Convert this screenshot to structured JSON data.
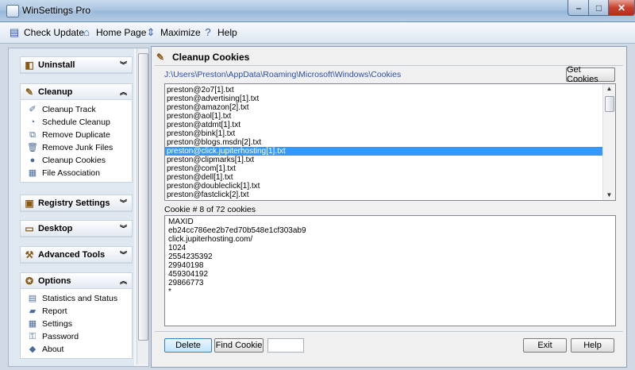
{
  "window": {
    "title": "WinSettings Pro"
  },
  "toolbar": {
    "items": [
      {
        "label": "Check Update",
        "icon": "check-update-icon"
      },
      {
        "label": "Home Page",
        "icon": "home-page-icon"
      },
      {
        "label": "Maximize",
        "icon": "maximize-icon"
      },
      {
        "label": "Help",
        "icon": "help-icon"
      }
    ]
  },
  "sidebar": {
    "groups": [
      {
        "label": "Uninstall",
        "icon": "uninstall-icon",
        "expanded": false
      },
      {
        "label": "Cleanup",
        "icon": "cleanup-icon",
        "expanded": true,
        "items": [
          {
            "label": "Cleanup Track",
            "icon": "cleanup-track-icon"
          },
          {
            "label": "Schedule Cleanup",
            "icon": "schedule-cleanup-icon"
          },
          {
            "label": "Remove Duplicate",
            "icon": "remove-duplicate-icon"
          },
          {
            "label": "Remove Junk Files",
            "icon": "remove-junk-icon"
          },
          {
            "label": "Cleanup Cookies",
            "icon": "cleanup-cookies-icon"
          },
          {
            "label": "File Association",
            "icon": "file-association-icon"
          }
        ]
      },
      {
        "label": "Registry Settings",
        "icon": "registry-icon",
        "expanded": false
      },
      {
        "label": "Desktop",
        "icon": "desktop-icon",
        "expanded": false
      },
      {
        "label": "Advanced Tools",
        "icon": "advanced-tools-icon",
        "expanded": false
      },
      {
        "label": "Options",
        "icon": "options-icon",
        "expanded": true,
        "items": [
          {
            "label": "Statistics and Status",
            "icon": "statistics-icon"
          },
          {
            "label": "Report",
            "icon": "report-icon"
          },
          {
            "label": "Settings",
            "icon": "settings-icon"
          },
          {
            "label": "Password",
            "icon": "password-icon"
          },
          {
            "label": "About",
            "icon": "about-icon"
          }
        ]
      }
    ]
  },
  "main": {
    "title": "Cleanup Cookies",
    "path": "J:\\Users\\Preston\\AppData\\Roaming\\Microsoft\\Windows\\Cookies",
    "get_cookies_label": "Get Cookies",
    "cookies": [
      "preston@2o7[1].txt",
      "preston@advertising[1].txt",
      "preston@amazon[2].txt",
      "preston@aol[1].txt",
      "preston@atdmt[1].txt",
      "preston@bink[1].txt",
      "preston@blogs.msdn[2].txt",
      "preston@click.jupiterhosting[1].txt",
      "preston@clipmarks[1].txt",
      "preston@com[1].txt",
      "preston@dell[1].txt",
      "preston@doubleclick[1].txt",
      "preston@fastclick[2].txt"
    ],
    "selected_index": 7,
    "cookie_counter": "Cookie #  8 of  72 cookies",
    "details": [
      "MAXID",
      "eb24cc786ee2b7ed70b548e1cf303ab9",
      "click.jupiterhosting.com/",
      "1024",
      "2554235392",
      "29940198",
      "459304192",
      "29866773",
      "*"
    ],
    "delete_label": "Delete",
    "find_label": "Find Cookie",
    "exit_label": "Exit",
    "help_label": "Help"
  },
  "colors": {
    "selection": "#3399ff",
    "path_text": "#2b4fa4"
  }
}
